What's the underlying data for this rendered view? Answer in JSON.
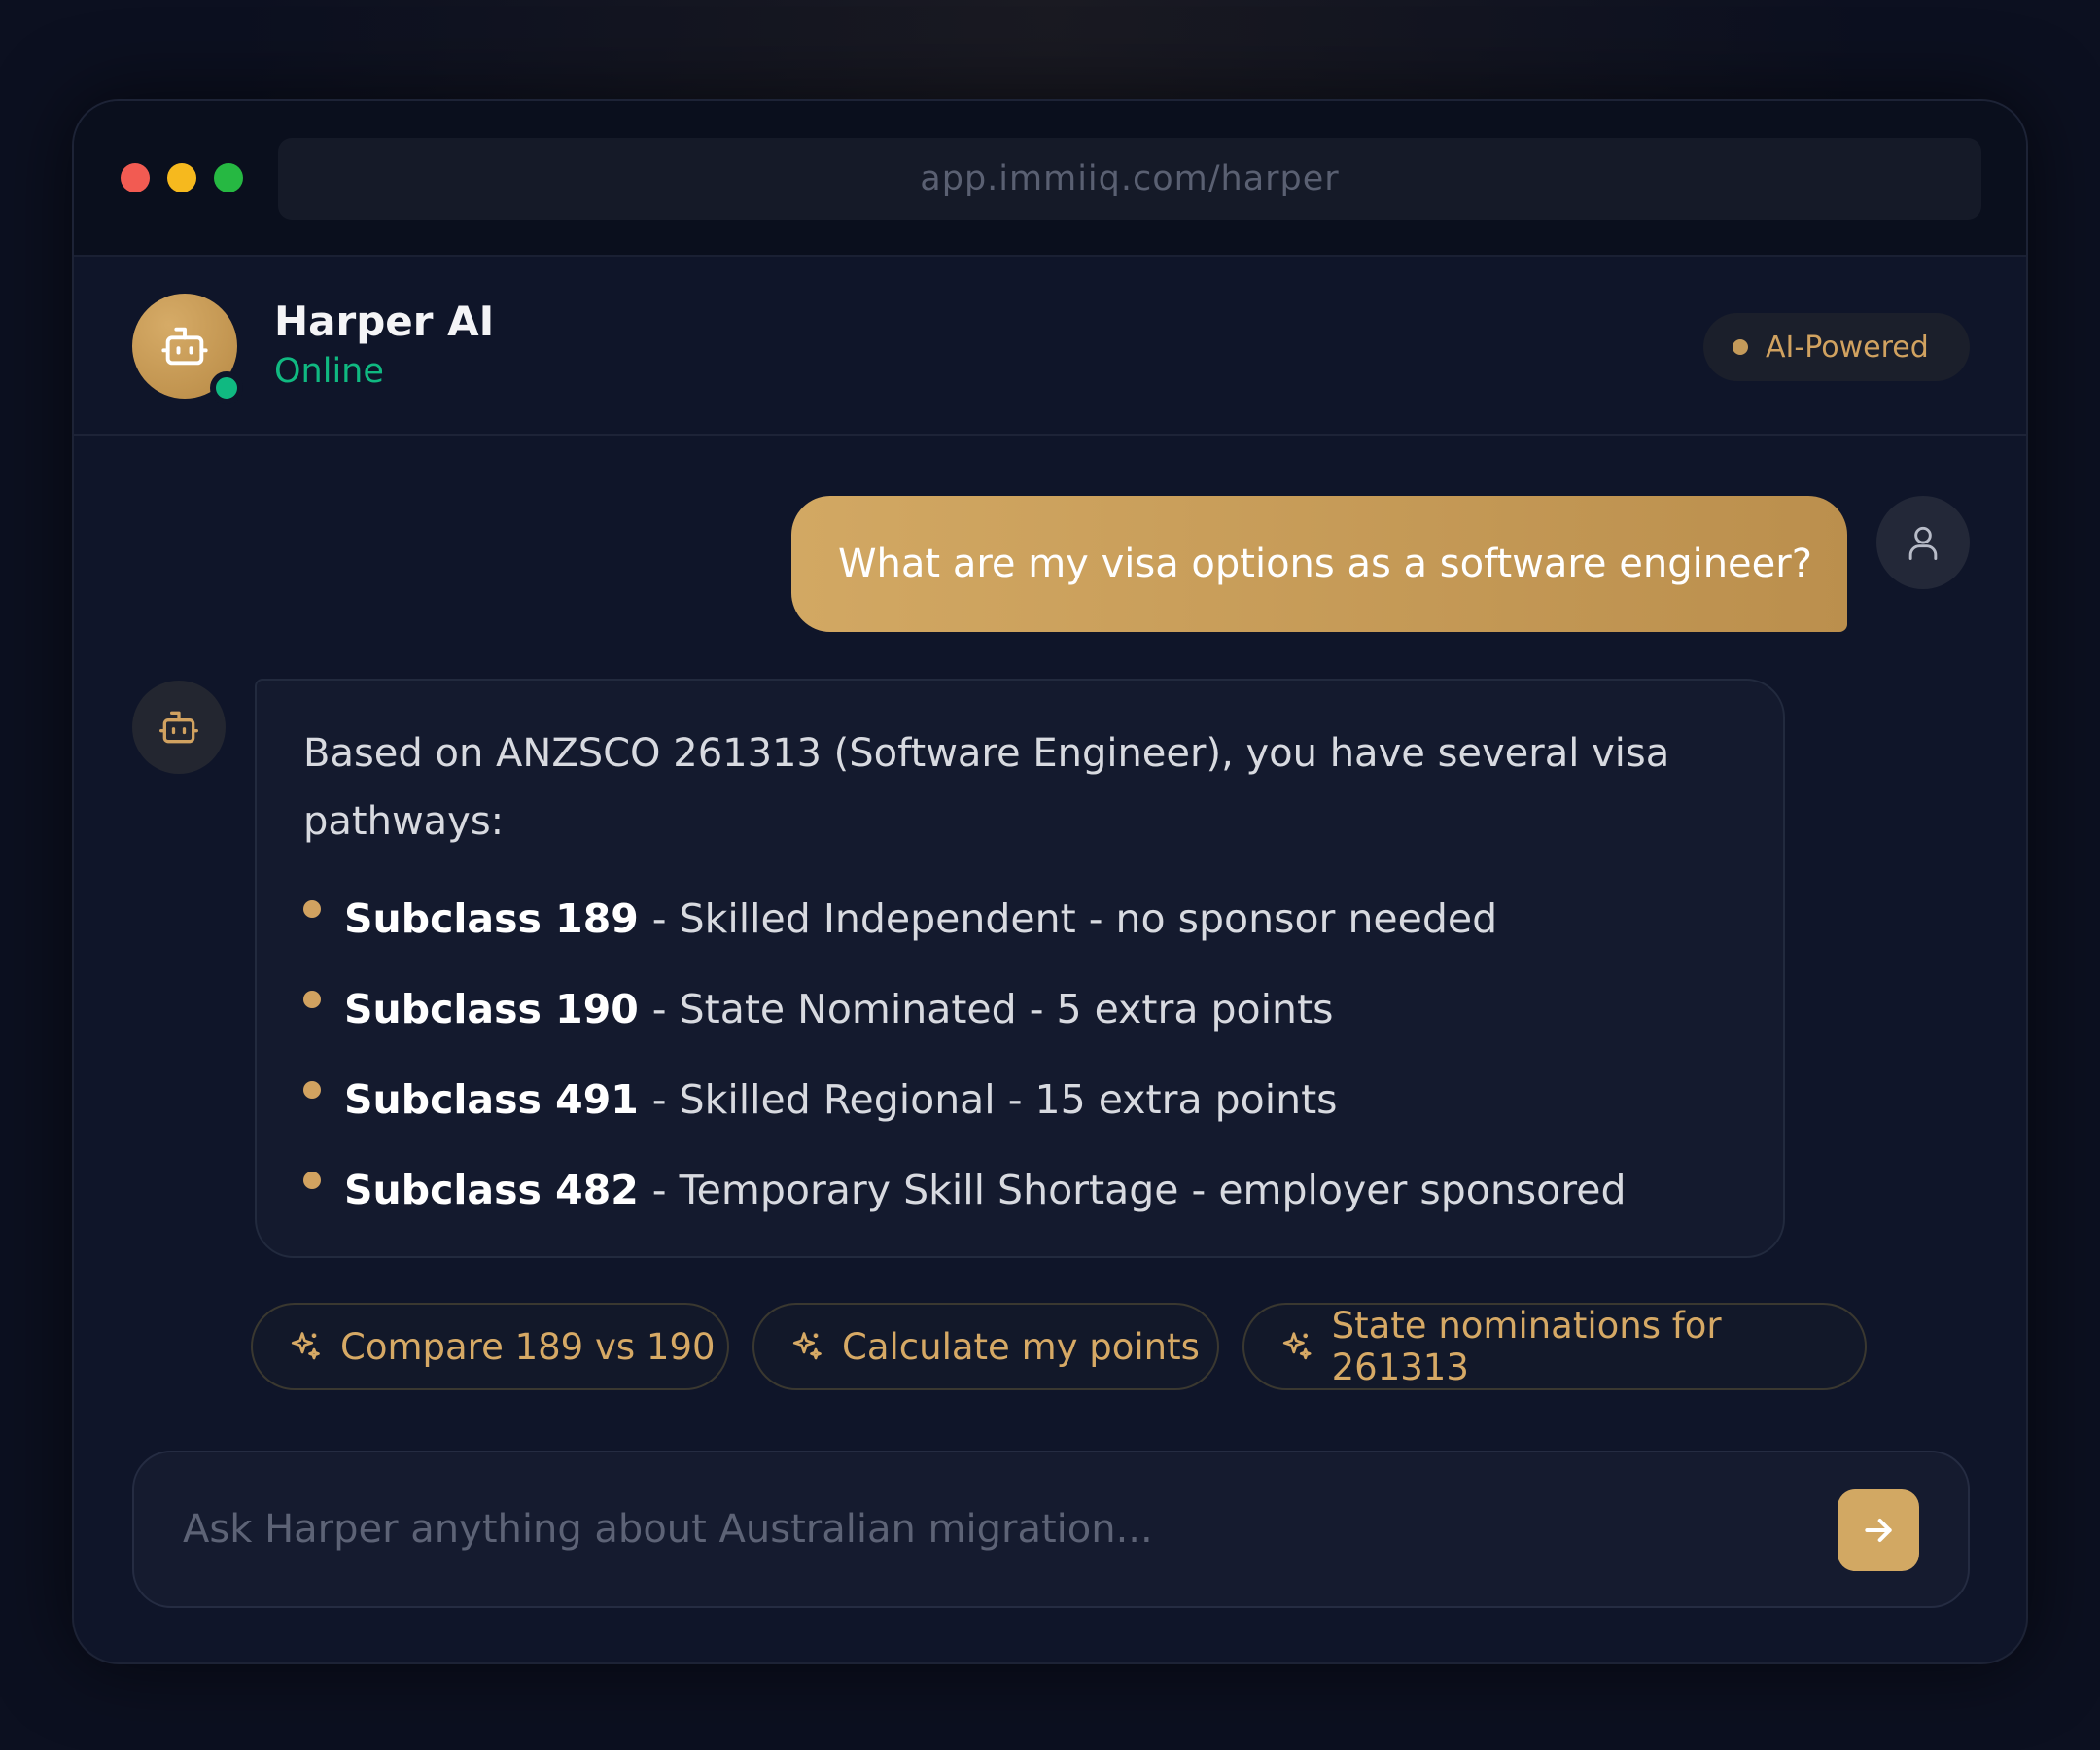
{
  "browser": {
    "url": "app.immiiq.com/harper"
  },
  "header": {
    "agent_name": "Harper AI",
    "status": "Online",
    "badge": "AI-Powered"
  },
  "conversation": {
    "user_message": "What are my visa options as a software engineer?",
    "bot_intro": "Based on ANZSCO 261313 (Software Engineer), you have several visa pathways:",
    "bot_items": [
      {
        "title": "Subclass 189",
        "detail": "- Skilled Independent - no sponsor needed"
      },
      {
        "title": "Subclass 190",
        "detail": "- State Nominated - 5 extra points"
      },
      {
        "title": "Subclass 491",
        "detail": "- Skilled Regional - 15 extra points"
      },
      {
        "title": "Subclass 482",
        "detail": "- Temporary Skill Shortage - employer sponsored"
      }
    ]
  },
  "suggestions": [
    {
      "label": "Compare 189 vs 190",
      "icon": "sparkle-icon"
    },
    {
      "label": "Calculate my points",
      "icon": "sparkle-icon"
    },
    {
      "label": "State nominations for 261313",
      "icon": "sparkle-icon"
    }
  ],
  "composer": {
    "placeholder": "Ask Harper anything about Australian migration...",
    "value": "",
    "send_icon": "arrow-right-icon"
  },
  "colors": {
    "accent": "#d2a863",
    "online": "#10b981",
    "background": "#0f1529"
  }
}
